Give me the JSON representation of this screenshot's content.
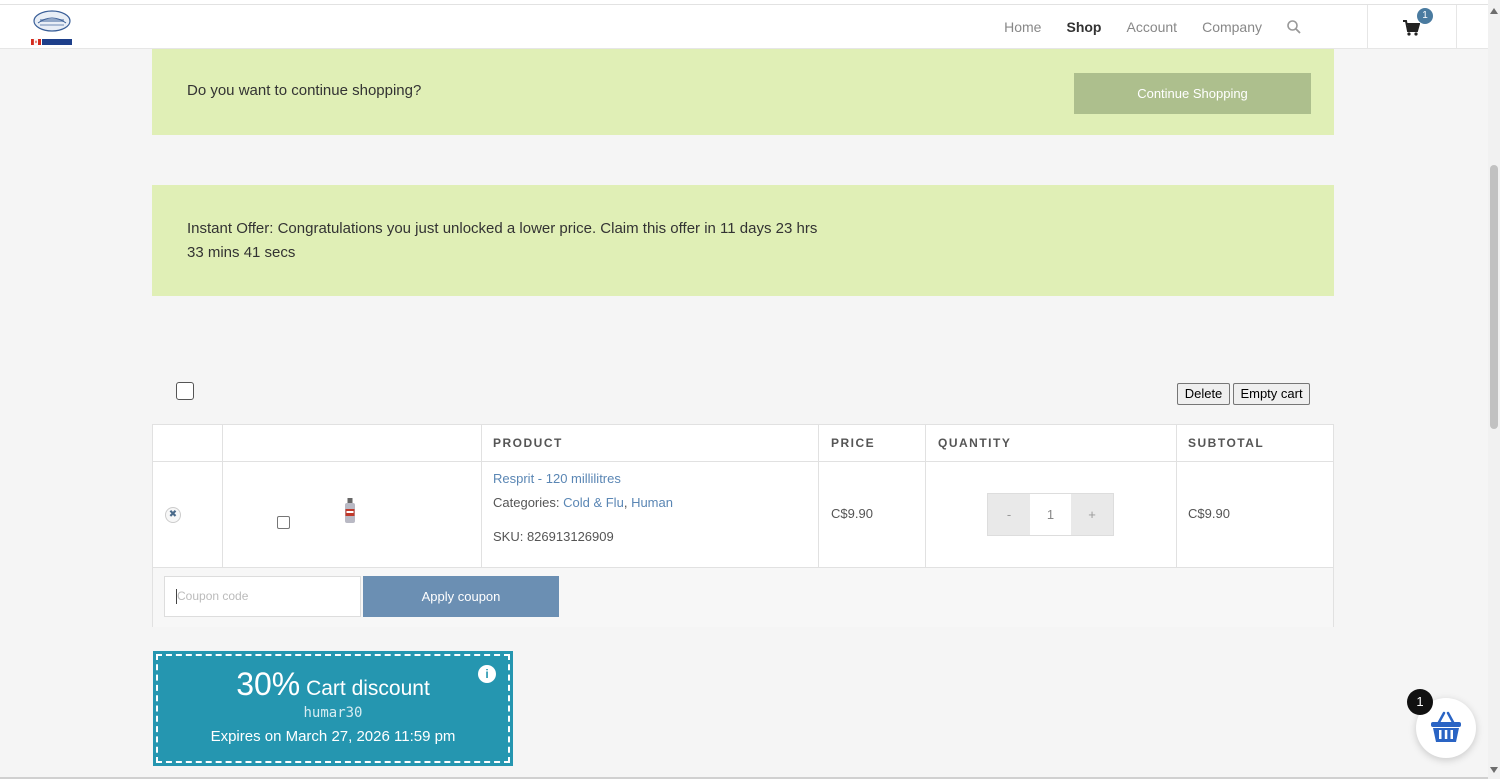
{
  "header": {
    "logo_alt": "Omega Alpha Store",
    "nav": [
      "Home",
      "Shop",
      "Account",
      "Company"
    ],
    "active_nav": "Shop",
    "cart_count": "1"
  },
  "notice_continue": {
    "message": "Do you want to continue shopping?",
    "button": "Continue Shopping"
  },
  "notice_offer": {
    "message": "Instant Offer: Congratulations you just unlocked a lower price. Claim this offer in 11 days 23 hrs 33 mins 41 secs"
  },
  "cart_tools": {
    "delete": "Delete",
    "empty_cart": "Empty cart"
  },
  "table": {
    "headers": [
      "PRODUCT",
      "PRICE",
      "QUANTITY",
      "SUBTOTAL"
    ],
    "row": {
      "product_name": "Resprit - 120 millilitres",
      "categories_label": "Categories:",
      "category_1": "Cold & Flu",
      "category_sep": ",",
      "category_2": "Human",
      "sku": "SKU: 826913126909",
      "price": "C$9.90",
      "quantity": "1",
      "minus": "-",
      "plus": "+",
      "subtotal": "C$9.90"
    }
  },
  "coupon": {
    "placeholder": "Coupon code",
    "button": "Apply coupon"
  },
  "discount": {
    "percent": "30%",
    "label": "Cart discount",
    "code": "humar30",
    "expires": "Expires on March 27, 2026 11:59 pm",
    "info": "i"
  },
  "floating_cart": {
    "count": "1"
  },
  "colors": {
    "notice_bg": "#e0efb6",
    "continue_btn": "#adbf8d",
    "apply_btn": "#6b8fb3",
    "discount_bg": "#2596b0",
    "link": "#5a86b4"
  }
}
